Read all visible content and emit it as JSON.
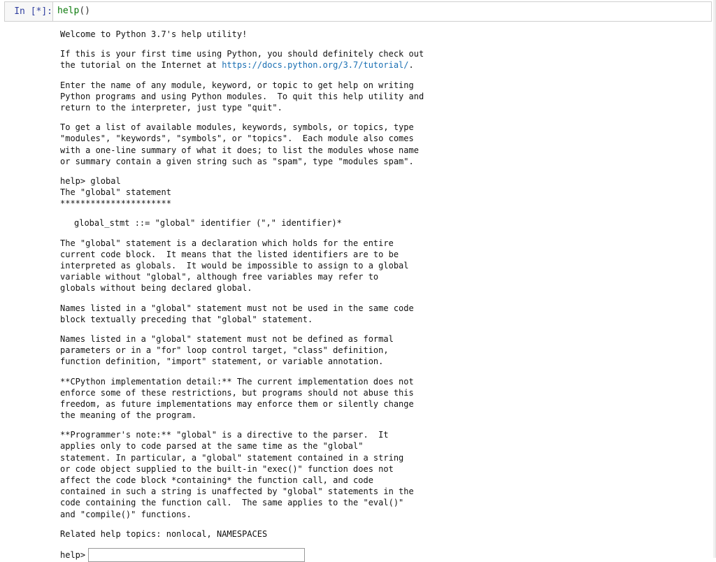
{
  "cell": {
    "prompt_in": "In ",
    "prompt_open": "[",
    "prompt_star": "*",
    "prompt_close": "]:",
    "code_builtin": "help",
    "code_parens": "()"
  },
  "output": {
    "welcome": "Welcome to Python 3.7's help utility!",
    "intro1": "If this is your first time using Python, you should definitely check out\nthe tutorial on the Internet at ",
    "tutorial_link_text": "https://docs.python.org/3.7/tutorial/",
    "intro1_end": ".",
    "intro2": "Enter the name of any module, keyword, or topic to get help on writing\nPython programs and using Python modules.  To quit this help utility and\nreturn to the interpreter, just type \"quit\".",
    "intro3": "To get a list of available modules, keywords, symbols, or topics, type\n\"modules\", \"keywords\", \"symbols\", or \"topics\".  Each module also comes\nwith a one-line summary of what it does; to list the modules whose name\nor summary contain a given string such as \"spam\", type \"modules spam\".",
    "help_cmd": "help> global",
    "global_title": "The \"global\" statement",
    "stars": "**********************",
    "grammar": "global_stmt ::= \"global\" identifier (\",\" identifier)*",
    "p1": "The \"global\" statement is a declaration which holds for the entire\ncurrent code block.  It means that the listed identifiers are to be\ninterpreted as globals.  It would be impossible to assign to a global\nvariable without \"global\", although free variables may refer to\nglobals without being declared global.",
    "p2": "Names listed in a \"global\" statement must not be used in the same code\nblock textually preceding that \"global\" statement.",
    "p3": "Names listed in a \"global\" statement must not be defined as formal\nparameters or in a \"for\" loop control target, \"class\" definition,\nfunction definition, \"import\" statement, or variable annotation.",
    "p4": "**CPython implementation detail:** The current implementation does not\nenforce some of these restrictions, but programs should not abuse this\nfreedom, as future implementations may enforce them or silently change\nthe meaning of the program.",
    "p5": "**Programmer's note:** \"global\" is a directive to the parser.  It\napplies only to code parsed at the same time as the \"global\"\nstatement. In particular, a \"global\" statement contained in a string\nor code object supplied to the built-in \"exec()\" function does not\naffect the code block *containing* the function call, and code\ncontained in such a string is unaffected by \"global\" statements in the\ncode containing the function call.  The same applies to the \"eval()\"\nand \"compile()\" functions.",
    "related": "Related help topics: nonlocal, NAMESPACES",
    "help_prompt": "help>"
  }
}
